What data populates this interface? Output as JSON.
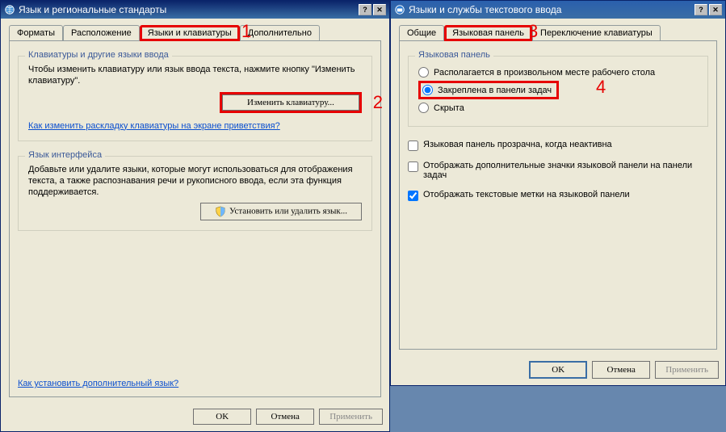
{
  "left": {
    "title": "Язык и региональные стандарты",
    "tabs": {
      "formats": "Форматы",
      "location": "Расположение",
      "langkb": "Языки и клавиатуры",
      "extra": "Дополнительно"
    },
    "annot1": "1",
    "group1": {
      "legend": "Клавиатуры и другие языки ввода",
      "text": "Чтобы изменить клавиатуру или язык ввода текста, нажмите кнопку \"Изменить клавиатуру\".",
      "btn": "Изменить клавиатуру...",
      "link": "Как изменить раскладку клавиатуры на экране приветствия?"
    },
    "annot2": "2",
    "group2": {
      "legend": "Язык интерфейса",
      "text": "Добавьте или удалите языки, которые могут использоваться для отображения текста, а также распознавания речи и рукописного ввода, если эта функция поддерживается.",
      "btn": "Установить или удалить язык..."
    },
    "bottomlink": "Как установить дополнительный язык?",
    "ok": "OK",
    "cancel": "Отмена",
    "apply": "Применить"
  },
  "right": {
    "title": "Языки и службы текстового ввода",
    "tabs": {
      "general": "Общие",
      "langbar": "Языковая панель",
      "switch": "Переключение клавиатуры"
    },
    "annot3": "3",
    "group1": {
      "legend": "Языковая панель",
      "r1": "Располагается в произвольном месте рабочего стола",
      "r2": "Закреплена в панели задач",
      "r3": "Скрыта"
    },
    "annot4": "4",
    "c1": "Языковая панель прозрачна, когда неактивна",
    "c2": "Отображать дополнительные значки языковой панели на панели задач",
    "c3": "Отображать текстовые метки на языковой панели",
    "ok": "OK",
    "cancel": "Отмена",
    "apply": "Применить"
  }
}
